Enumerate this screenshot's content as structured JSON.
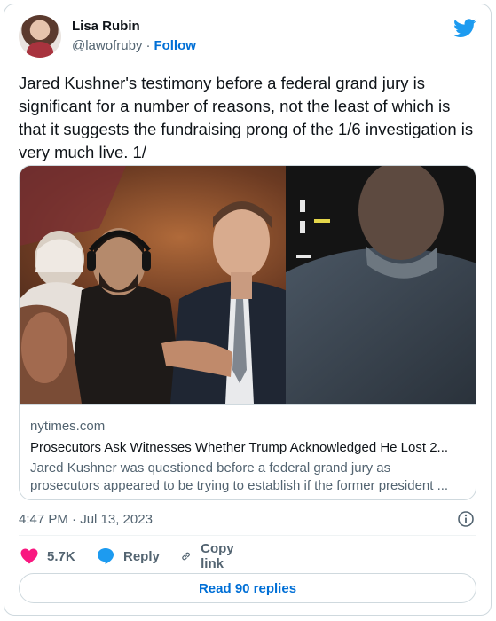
{
  "author": {
    "name": "Lisa Rubin",
    "handle": "@lawofruby",
    "separator": "·",
    "follow_label": "Follow"
  },
  "tweet": {
    "text": "Jared Kushner's testimony before a federal grand jury is significant for a number of reasons, not the least of which is that it suggests the fundraising prong of the 1/6 investigation is very much live. 1/"
  },
  "link_card": {
    "domain": "nytimes.com",
    "title": "Prosecutors Ask Witnesses Whether Trump Acknowledged He Lost 2...",
    "description_line1": "Jared Kushner was questioned before a federal grand jury as",
    "description_line2": "prosecutors appeared to be trying to establish if the former president ..."
  },
  "meta": {
    "timestamp": "4:47 PM · Jul 13, 2023"
  },
  "actions": {
    "like_count": "5.7K",
    "reply_label": "Reply",
    "copy_label": "Copy link"
  },
  "footer": {
    "read_replies_label": "Read 90 replies"
  },
  "colors": {
    "brand_blue": "#1d9bf0",
    "link_blue": "#006fd6",
    "like_pink": "#f91880",
    "secondary_text": "#536471",
    "border": "#cfd9de"
  },
  "icons": {
    "platform": "bird-icon",
    "info": "info-icon",
    "like": "heart-icon",
    "reply": "speech-bubble-icon",
    "copy": "link-icon"
  }
}
